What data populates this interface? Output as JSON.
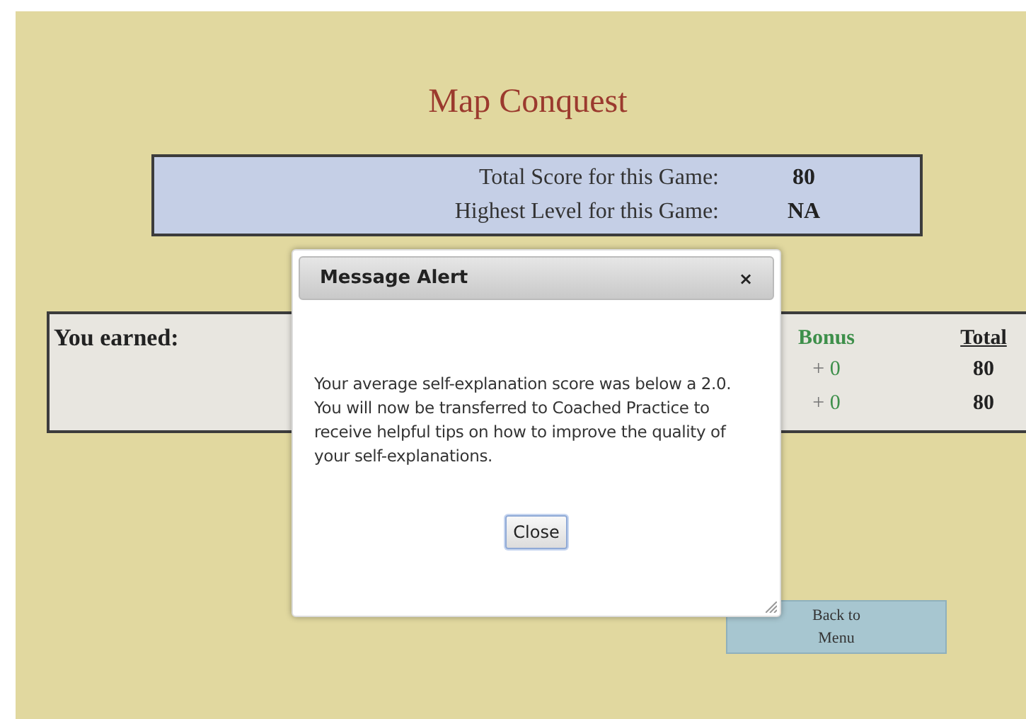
{
  "title": "Map Conquest",
  "score_box": {
    "rows": [
      {
        "label": "Total Score for this Game:",
        "value": "80"
      },
      {
        "label": "Highest Level for this Game:",
        "value": "NA"
      }
    ]
  },
  "earned": {
    "label": "You earned:",
    "columns": [
      "Bonus",
      "Total"
    ],
    "rows": [
      {
        "sign": "+",
        "bonus": "0",
        "total": "80"
      },
      {
        "sign": "+",
        "bonus": "0",
        "total": "80"
      }
    ]
  },
  "back_button": {
    "label": "Back to Menu"
  },
  "dialog": {
    "title": "Message Alert",
    "close_glyph": "×",
    "message": "Your average self-explanation score was below a 2.0. You will now be transferred to Coached Practice to receive helpful tips on how to improve the quality of your self-explanations.",
    "button": "Close"
  }
}
